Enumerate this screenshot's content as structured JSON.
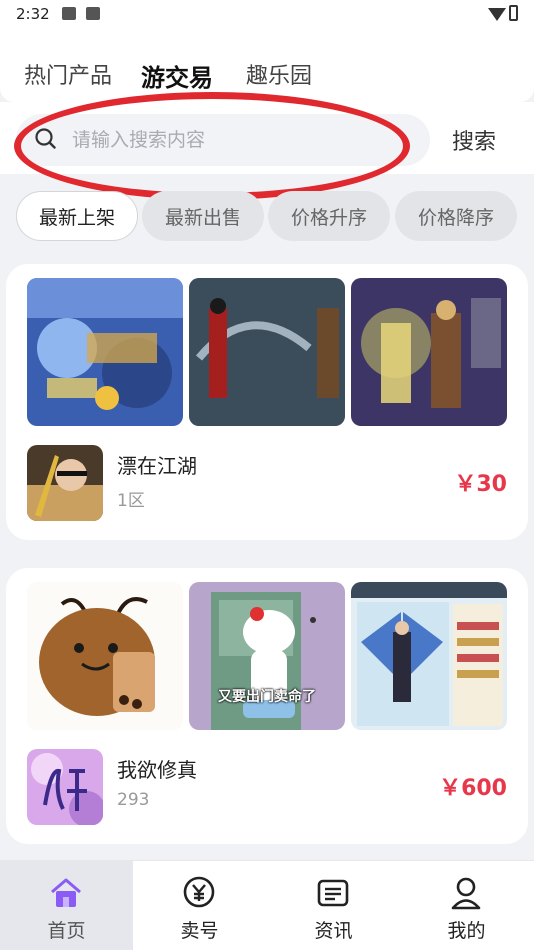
{
  "status_bar": {
    "time": "2:32"
  },
  "tabs": [
    "热门产品",
    "游交易",
    "趣乐园"
  ],
  "search": {
    "placeholder": "请输入搜索内容",
    "button": "搜索"
  },
  "sort_options": [
    "最新上架",
    "最新出售",
    "价格升序",
    "价格降序"
  ],
  "listings": [
    {
      "name": "漂在江湖",
      "server": "1区",
      "price": "￥30"
    },
    {
      "name": "我欲修真",
      "server": "293",
      "price": "￥600"
    }
  ],
  "meme_caption": "又要出门卖命了",
  "bottom_nav": [
    "首页",
    "卖号",
    "资讯",
    "我的"
  ],
  "colors": {
    "accent": "#e7374a",
    "home_icon": "#8a5cf5",
    "highlight_ring": "#e0282f"
  }
}
